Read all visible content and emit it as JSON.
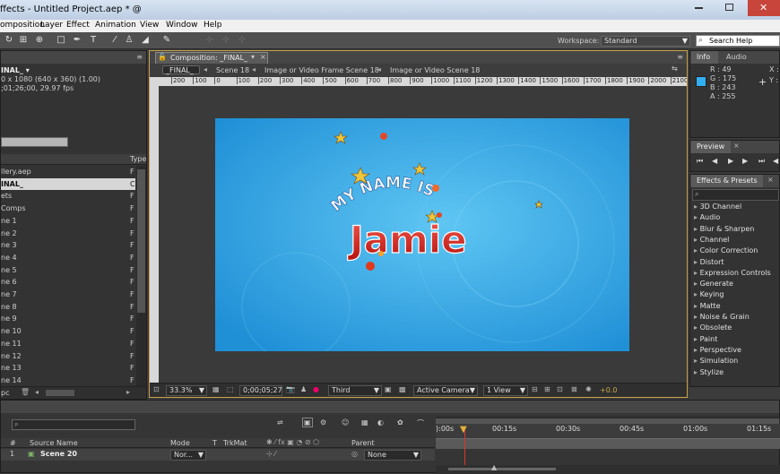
{
  "window": {
    "title": "ffects - Untitled Project.aep * @"
  },
  "menu": [
    "omposition",
    "Layer",
    "Effect",
    "Animation",
    "View",
    "Window",
    "Help"
  ],
  "workspace": {
    "label": "Workspace:",
    "value": "Standard"
  },
  "search_help": {
    "placeholder": "Search Help"
  },
  "project": {
    "comp_name": "INAL_ ▾",
    "info1": "0 x 1080  (640 x 360) (1.00)",
    "info2": ";01;26;00, 29.97 fps",
    "type_header": "Type",
    "rows": [
      {
        "name": "llery.aep",
        "type": "F"
      },
      {
        "name": "INAL_",
        "type": "C"
      },
      {
        "name": "ets",
        "type": "F"
      },
      {
        "name": "Comps",
        "type": "F"
      },
      {
        "name": "ne 1",
        "type": "F"
      },
      {
        "name": "ne 2",
        "type": "F"
      },
      {
        "name": "ne 3",
        "type": "F"
      },
      {
        "name": "ne 4",
        "type": "F"
      },
      {
        "name": "ne 5",
        "type": "F"
      },
      {
        "name": "ne 6",
        "type": "F"
      },
      {
        "name": "ne 7",
        "type": "F"
      },
      {
        "name": "ne 8",
        "type": "F"
      },
      {
        "name": "ne 9",
        "type": "F"
      },
      {
        "name": "ne 10",
        "type": "F"
      },
      {
        "name": "ne 11",
        "type": "F"
      },
      {
        "name": "ne 12",
        "type": "F"
      },
      {
        "name": "ne 13",
        "type": "F"
      },
      {
        "name": "ne 14",
        "type": "F"
      }
    ],
    "bpc": "pc"
  },
  "composition": {
    "tab": "Composition: _FINAL_",
    "breadcrumbs": [
      "_FINAL_",
      "Scene 18",
      "Image or Video Frame Scene 18",
      "Image or Video Scene 18"
    ],
    "ruler": [
      "200",
      "100",
      "0",
      "100",
      "200",
      "300",
      "400",
      "500",
      "600",
      "700",
      "800",
      "900",
      "1000",
      "1100",
      "1200",
      "1300",
      "1400",
      "1500",
      "1600",
      "1700",
      "1800",
      "1900",
      "2000",
      "2100"
    ],
    "artwork": {
      "subtitle": "MY NAME IS",
      "name": "Jamie"
    },
    "zoom": "33.3%",
    "timecode": "0;00;05;27",
    "view_res": "Third",
    "camera": "Active Camera",
    "views": "1 View",
    "exposure": "+0.0"
  },
  "info": {
    "tab_info": "Info",
    "tab_audio": "Audio",
    "r": "R : 49",
    "g": "G : 175",
    "b": "B : 243",
    "a": "A : 255",
    "x": "X :",
    "y": "Y :",
    "swatch_color": "#31aff3"
  },
  "preview": {
    "tab": "Preview"
  },
  "effects": {
    "tab": "Effects & Presets",
    "items": [
      "3D Channel",
      "Audio",
      "Blur & Sharpen",
      "Channel",
      "Color Correction",
      "Distort",
      "Expression Controls",
      "Generate",
      "Keying",
      "Matte",
      "Noise & Grain",
      "Obsolete",
      "Paint",
      "Perspective",
      "Simulation",
      "Stylize"
    ]
  },
  "timeline": {
    "headers": {
      "source": "Source Name",
      "mode": "Mode",
      "t": "T",
      "trkmat": "TrkMat",
      "parent": "Parent"
    },
    "layer": {
      "index": "1",
      "name": "Scene 20",
      "mode": "Nor...",
      "parent": "None"
    },
    "times": [
      "):00s",
      "00:15s",
      "00:30s",
      "00:45s",
      "01:00s",
      "01:15s"
    ]
  }
}
